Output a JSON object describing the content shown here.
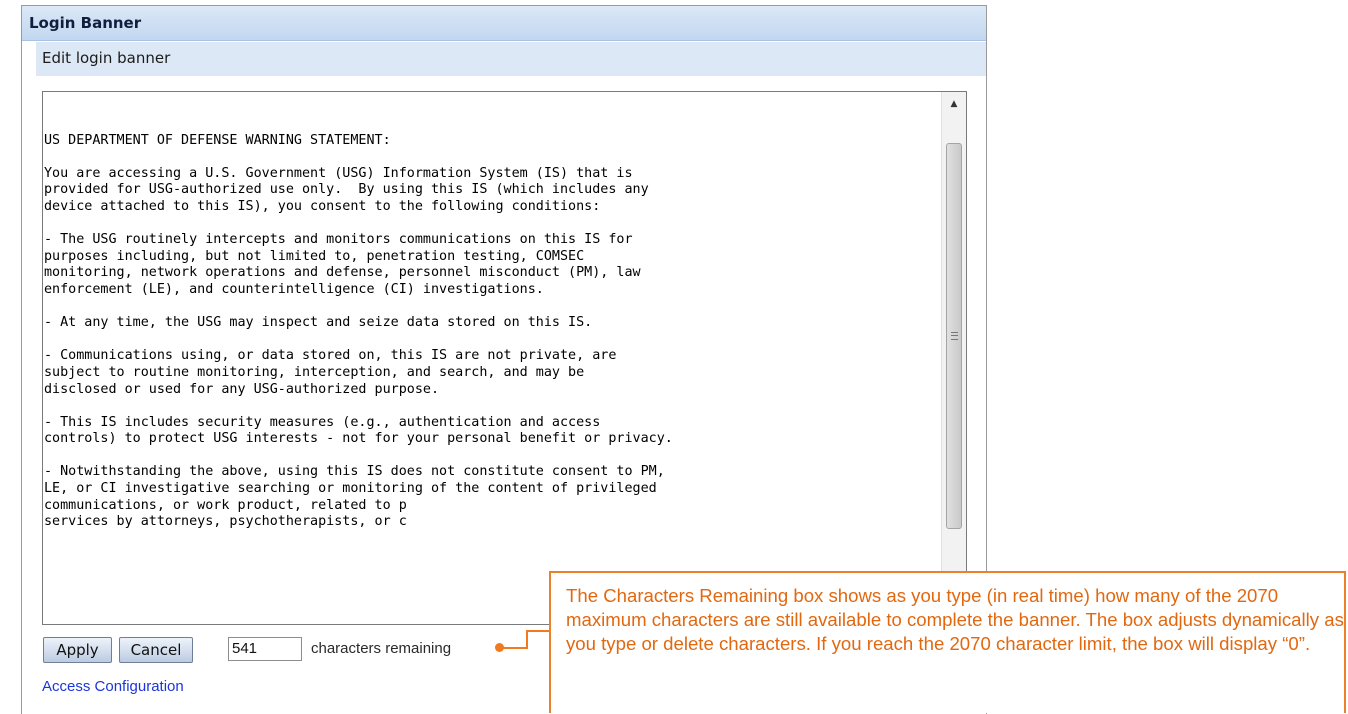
{
  "header": {
    "title": "Login Banner",
    "subtitle": "Edit login banner"
  },
  "banner_text": "\nUS DEPARTMENT OF DEFENSE WARNING STATEMENT:\n\nYou are accessing a U.S. Government (USG) Information System (IS) that is\nprovided for USG-authorized use only.  By using this IS (which includes any\ndevice attached to this IS), you consent to the following conditions:\n\n- The USG routinely intercepts and monitors communications on this IS for\npurposes including, but not limited to, penetration testing, COMSEC\nmonitoring, network operations and defense, personnel misconduct (PM), law\nenforcement (LE), and counterintelligence (CI) investigations.\n\n- At any time, the USG may inspect and seize data stored on this IS.\n\n- Communications using, or data stored on, this IS are not private, are\nsubject to routine monitoring, interception, and search, and may be\ndisclosed or used for any USG-authorized purpose.\n\n- This IS includes security measures (e.g., authentication and access\ncontrols) to protect USG interests - not for your personal benefit or privacy.\n\n- Notwithstanding the above, using this IS does not constitute consent to PM,\nLE, or CI investigative searching or monitoring of the content of privileged\ncommunications, or work product, related to p\nservices by attorneys, psychotherapists, or c",
  "actions": {
    "apply_label": "Apply",
    "cancel_label": "Cancel"
  },
  "char_count": {
    "value": "541",
    "label": "characters remaining"
  },
  "links": {
    "access_configuration": "Access Configuration"
  },
  "callout": {
    "text": "The Characters Remaining box shows as you type (in real time) how many of the 2070 maximum characters are still available to complete the banner. The box adjusts dynamically as you type or delete characters. If you reach the 2070 character limit, the box will display “0”."
  },
  "colors": {
    "callout": "#e26810",
    "link": "#1b36d8",
    "header_bg": "#c2d7f0"
  }
}
